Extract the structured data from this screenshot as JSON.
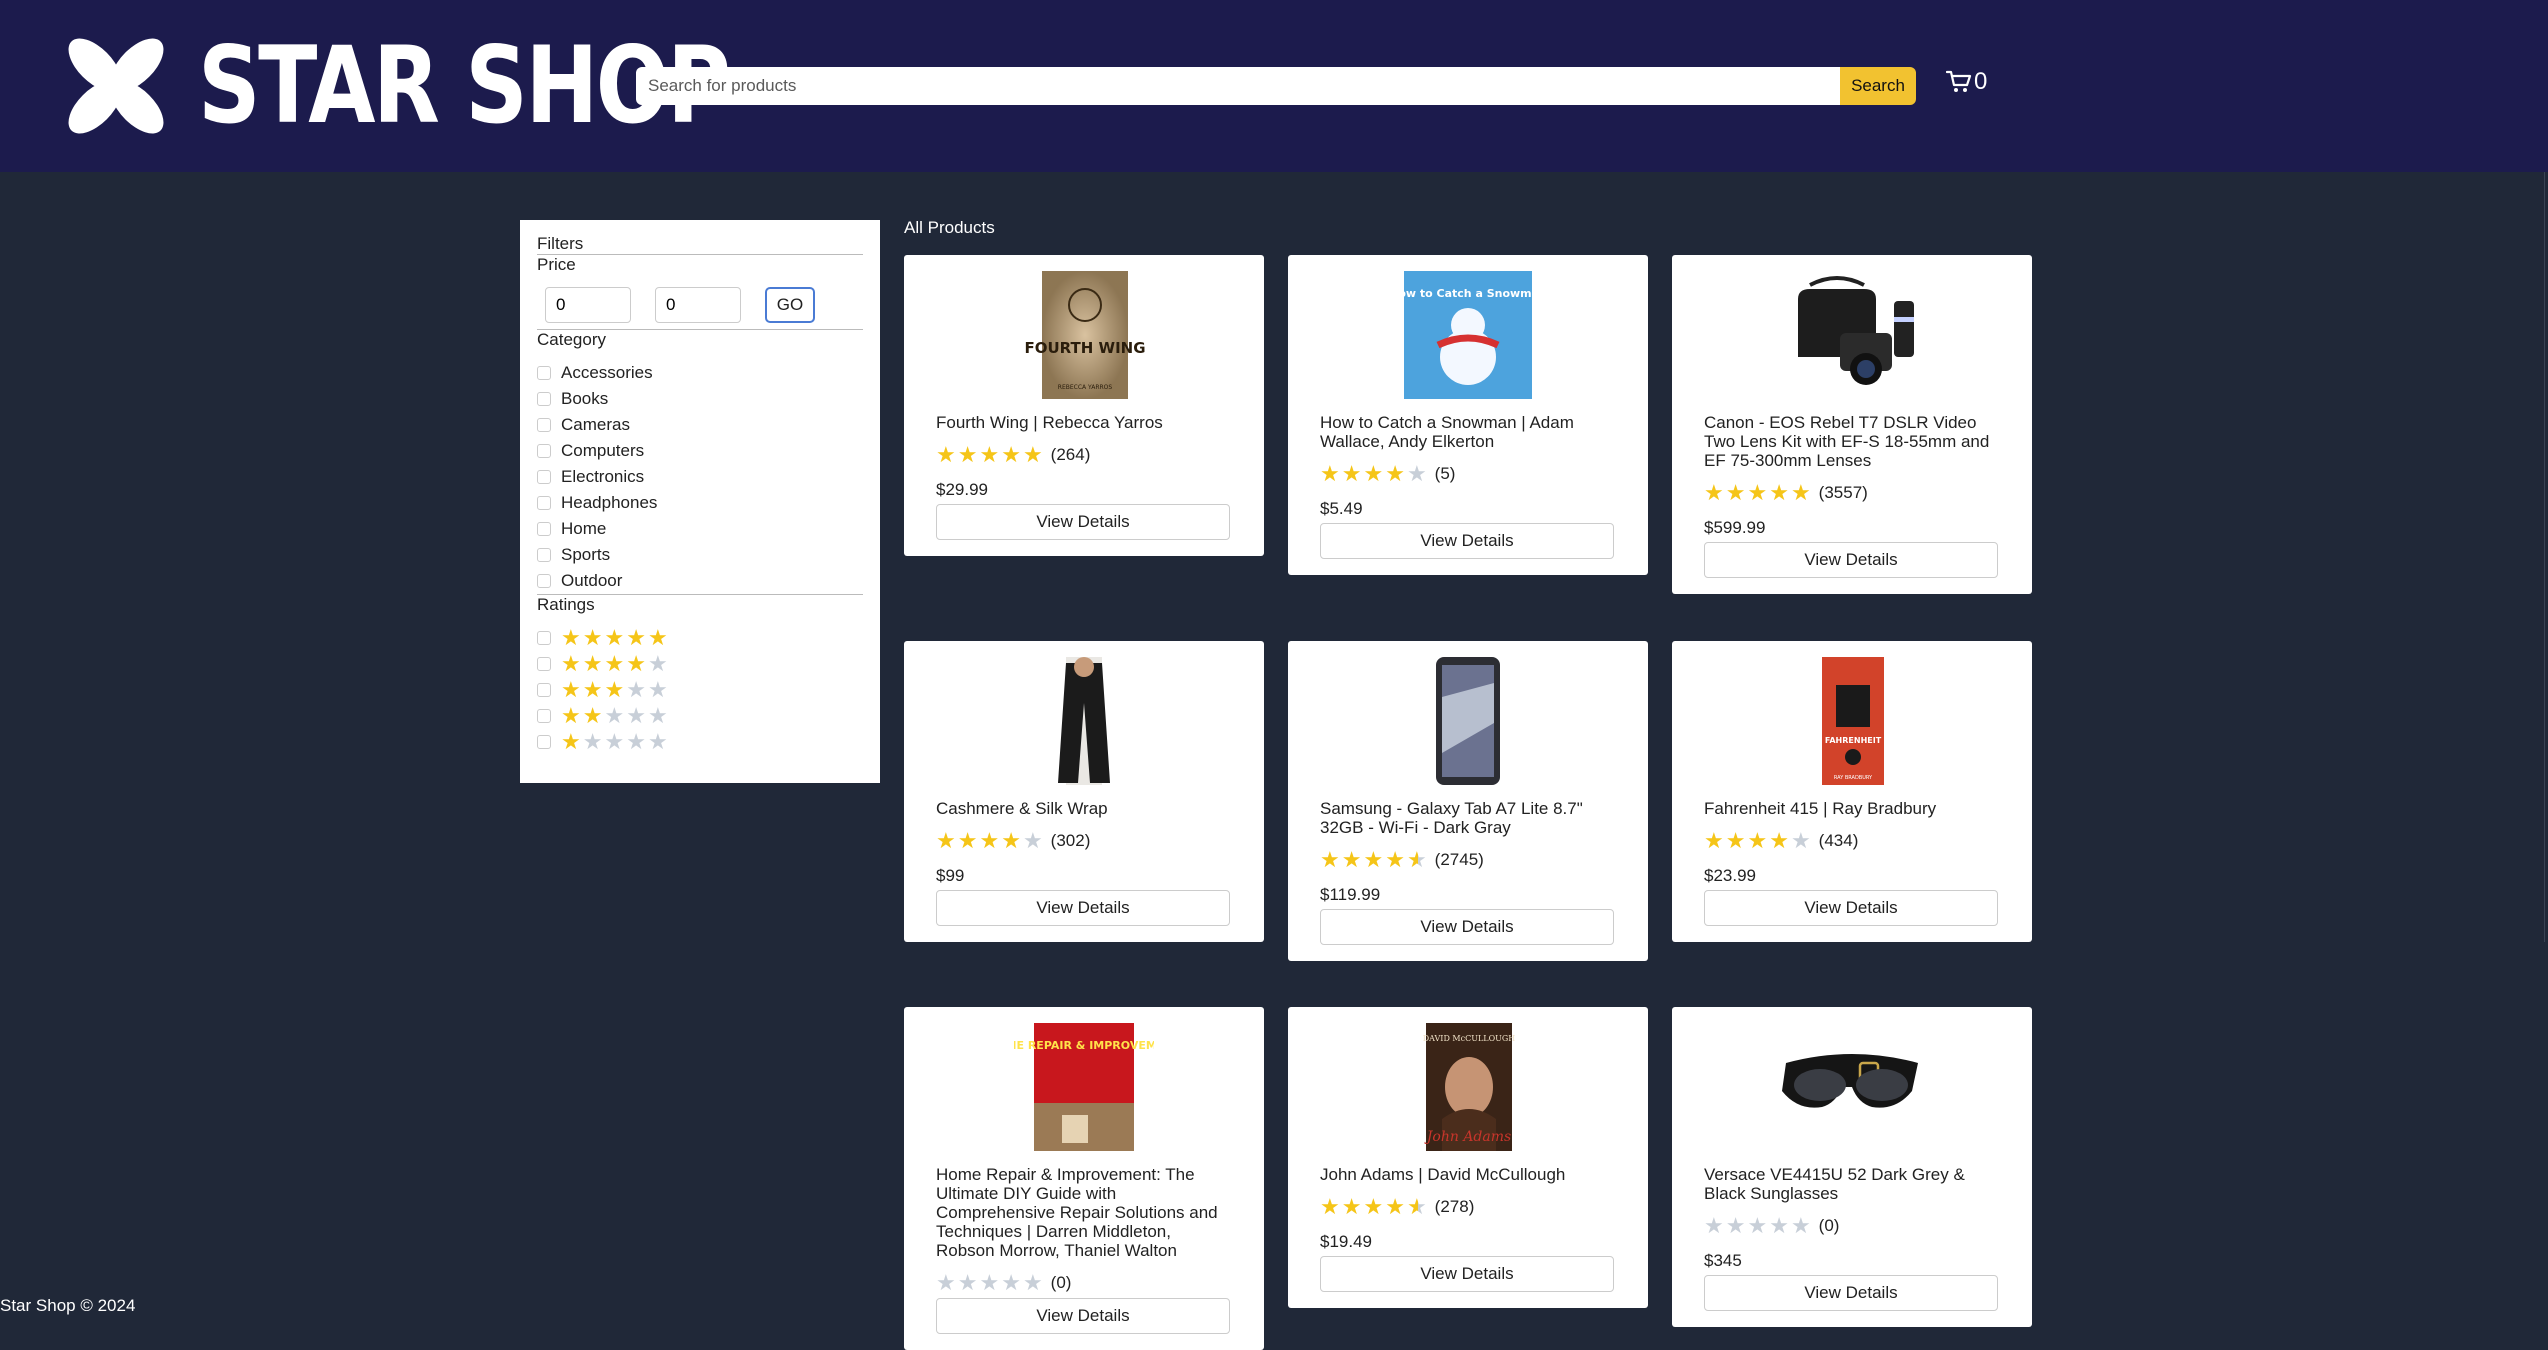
{
  "brand": {
    "name": "STAR SHOP",
    "logo_icon": "star-flower-logo"
  },
  "search": {
    "placeholder": "Search for products",
    "value": "",
    "button_label": "Search"
  },
  "cart": {
    "icon": "cart-icon",
    "count": "0"
  },
  "filters": {
    "title": "Filters",
    "price": {
      "label": "Price",
      "min": "0",
      "max": "0",
      "go_label": "GO"
    },
    "category": {
      "label": "Category",
      "items": [
        "Accessories",
        "Books",
        "Cameras",
        "Computers",
        "Electronics",
        "Headphones",
        "Home",
        "Sports",
        "Outdoor"
      ]
    },
    "ratings": {
      "label": "Ratings",
      "levels": [
        5,
        4,
        3,
        2,
        1
      ]
    }
  },
  "products_title": "All Products",
  "products": [
    {
      "name": "Fourth Wing | Rebecca Yarros",
      "rating": 5,
      "reviews": "(264)",
      "price": "$29.99",
      "button": "View Details",
      "image_text": "FOURTH WING",
      "image_sub": "REBECCA YARROS"
    },
    {
      "name": "How to Catch a Snowman | Adam Wallace, Andy Elkerton",
      "rating": 4,
      "reviews": "(5)",
      "price": "$5.49",
      "button": "View Details",
      "image_text": "How to Catch a Snowman"
    },
    {
      "name": "Canon - EOS Rebel T7 DSLR Video Two Lens Kit with EF-S 18-55mm and EF 75-300mm Lenses",
      "rating": 5,
      "reviews": "(3557)",
      "price": "$599.99",
      "button": "View Details"
    },
    {
      "name": "Cashmere & Silk Wrap",
      "rating": 4,
      "reviews": "(302)",
      "price": "$99",
      "button": "View Details"
    },
    {
      "name": "Samsung - Galaxy Tab A7 Lite 8.7\" 32GB - Wi-Fi - Dark Gray",
      "rating": 4.5,
      "reviews": "(2745)",
      "price": "$119.99",
      "button": "View Details"
    },
    {
      "name": "Fahrenheit 415 | Ray Bradbury",
      "rating": 4,
      "reviews": "(434)",
      "price": "$23.99",
      "button": "View Details",
      "image_text": "FAHRENHEIT",
      "image_sub": "RAY BRADBURY"
    },
    {
      "name": "Home Repair & Improvement: The Ultimate DIY Guide with Comprehensive Repair Solutions and Techniques | Darren Middleton, Robson Morrow, Thaniel Walton",
      "rating": 0,
      "reviews": "(0)",
      "price": "",
      "button": "View Details",
      "image_text": "HOME REPAIR & IMPROVEMENT"
    },
    {
      "name": "John Adams | David McCullough",
      "rating": 4.5,
      "reviews": "(278)",
      "price": "$19.49",
      "button": "View Details",
      "image_text": "DAVID McCULLOUGH",
      "image_sub": "John Adams"
    },
    {
      "name": "Versace VE4415U 52 Dark Grey & Black Sunglasses",
      "rating": 0,
      "reviews": "(0)",
      "price": "$345",
      "button": "View Details"
    }
  ],
  "footer": "Star Shop © 2024",
  "colors": {
    "header_bg": "#1c1b4d",
    "page_bg": "#202838",
    "accent": "#f2c230",
    "star": "#f5c518"
  }
}
